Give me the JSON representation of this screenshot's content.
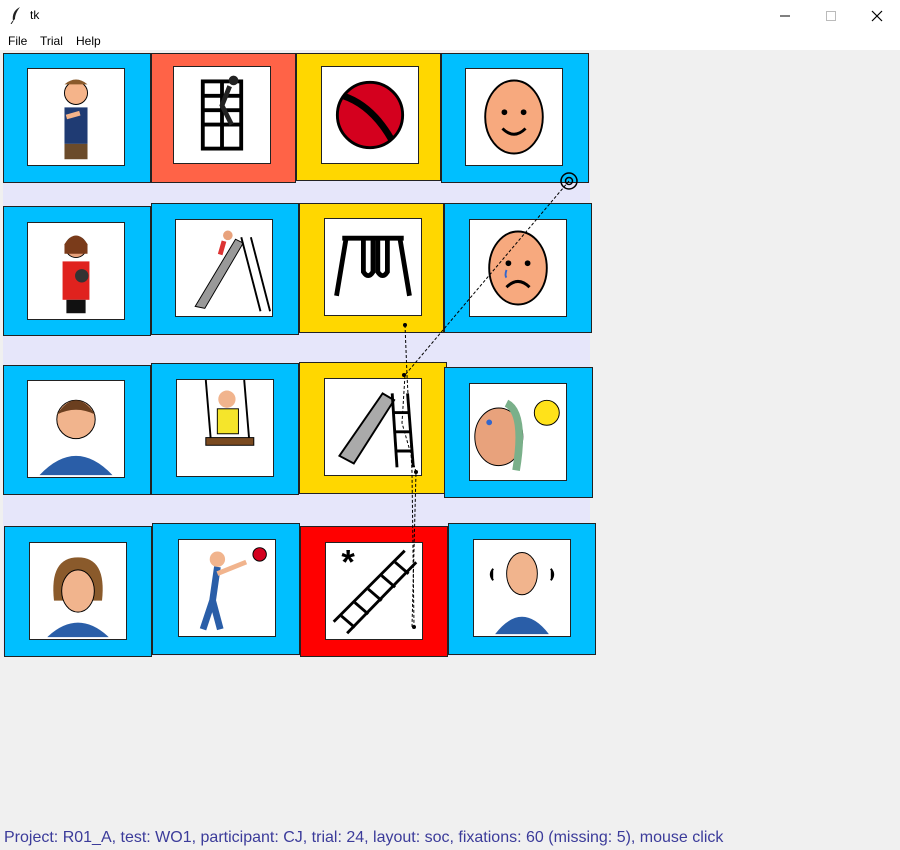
{
  "window": {
    "title": "tk",
    "icon": "feather-icon"
  },
  "menu": {
    "file": "File",
    "trial": "Trial",
    "help": "Help"
  },
  "colors": {
    "blue": "#00bfff",
    "orange": "#ff6347",
    "gold": "#ffd700",
    "red": "#ff0000",
    "board": "#e6e6fa",
    "status_text": "#3b3b9a"
  },
  "grid": {
    "rows": 4,
    "columns": 4,
    "cards": [
      {
        "name": "man-signing",
        "color": "blue"
      },
      {
        "name": "person-climbing",
        "color": "orange"
      },
      {
        "name": "ball",
        "color": "gold"
      },
      {
        "name": "happy-face",
        "color": "blue"
      },
      {
        "name": "woman-holding-baby",
        "color": "blue"
      },
      {
        "name": "child-on-slide",
        "color": "blue"
      },
      {
        "name": "swing-set",
        "color": "gold"
      },
      {
        "name": "sad-face",
        "color": "blue"
      },
      {
        "name": "man-portrait",
        "color": "blue"
      },
      {
        "name": "child-on-swing",
        "color": "blue"
      },
      {
        "name": "slide",
        "color": "gold"
      },
      {
        "name": "hot-face-sun",
        "color": "blue"
      },
      {
        "name": "girl-portrait",
        "color": "blue"
      },
      {
        "name": "boy-throwing-ball",
        "color": "blue"
      },
      {
        "name": "ladder-star",
        "color": "red"
      },
      {
        "name": "cold-person",
        "color": "blue"
      }
    ]
  },
  "status": "Project: R01_A, test: WO1, participant: CJ, trial: 24, layout: soc, fixations: 60 (missing: 5), mouse click"
}
